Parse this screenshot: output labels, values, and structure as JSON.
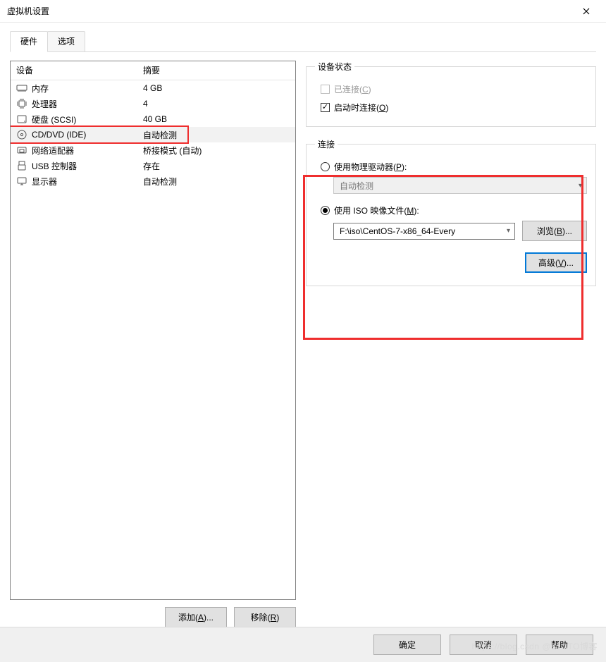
{
  "window": {
    "title": "虚拟机设置"
  },
  "tabs": {
    "hardware": "硬件",
    "options": "选项"
  },
  "list": {
    "header_device": "设备",
    "header_summary": "摘要",
    "rows": [
      {
        "name": "内存",
        "summary": "4 GB",
        "icon": "memory"
      },
      {
        "name": "处理器",
        "summary": "4",
        "icon": "cpu"
      },
      {
        "name": "硬盘 (SCSI)",
        "summary": "40 GB",
        "icon": "disk"
      },
      {
        "name": "CD/DVD (IDE)",
        "summary": "自动检测",
        "icon": "cd"
      },
      {
        "name": "网络适配器",
        "summary": "桥接模式 (自动)",
        "icon": "nic"
      },
      {
        "name": "USB 控制器",
        "summary": "存在",
        "icon": "usb"
      },
      {
        "name": "显示器",
        "summary": "自动检测",
        "icon": "display"
      }
    ]
  },
  "buttons": {
    "add": "添加(",
    "add_u": "A",
    "add_tail": ")...",
    "remove": "移除(",
    "remove_u": "R",
    "remove_tail": ")",
    "browse": "浏览(",
    "browse_u": "B",
    "browse_tail": ")...",
    "advanced": "高级(",
    "advanced_u": "V",
    "advanced_tail": ")...",
    "ok": "确定",
    "cancel": "取消",
    "help": "帮助"
  },
  "status": {
    "legend": "设备状态",
    "connected": "已连接(",
    "connected_u": "C",
    "connected_tail": ")",
    "connect_power": "启动时连接(",
    "connect_power_u": "O",
    "connect_power_tail": ")"
  },
  "connection": {
    "legend": "连接",
    "physical": "使用物理驱动器(",
    "physical_u": "P",
    "physical_tail": "):",
    "physical_combo": "自动检测",
    "iso": "使用 ISO 映像文件(",
    "iso_u": "M",
    "iso_tail": "):",
    "iso_path": "F:\\iso\\CentOS-7-x86_64-Every"
  },
  "watermark": "https://blog.csdn @51CTO博客"
}
